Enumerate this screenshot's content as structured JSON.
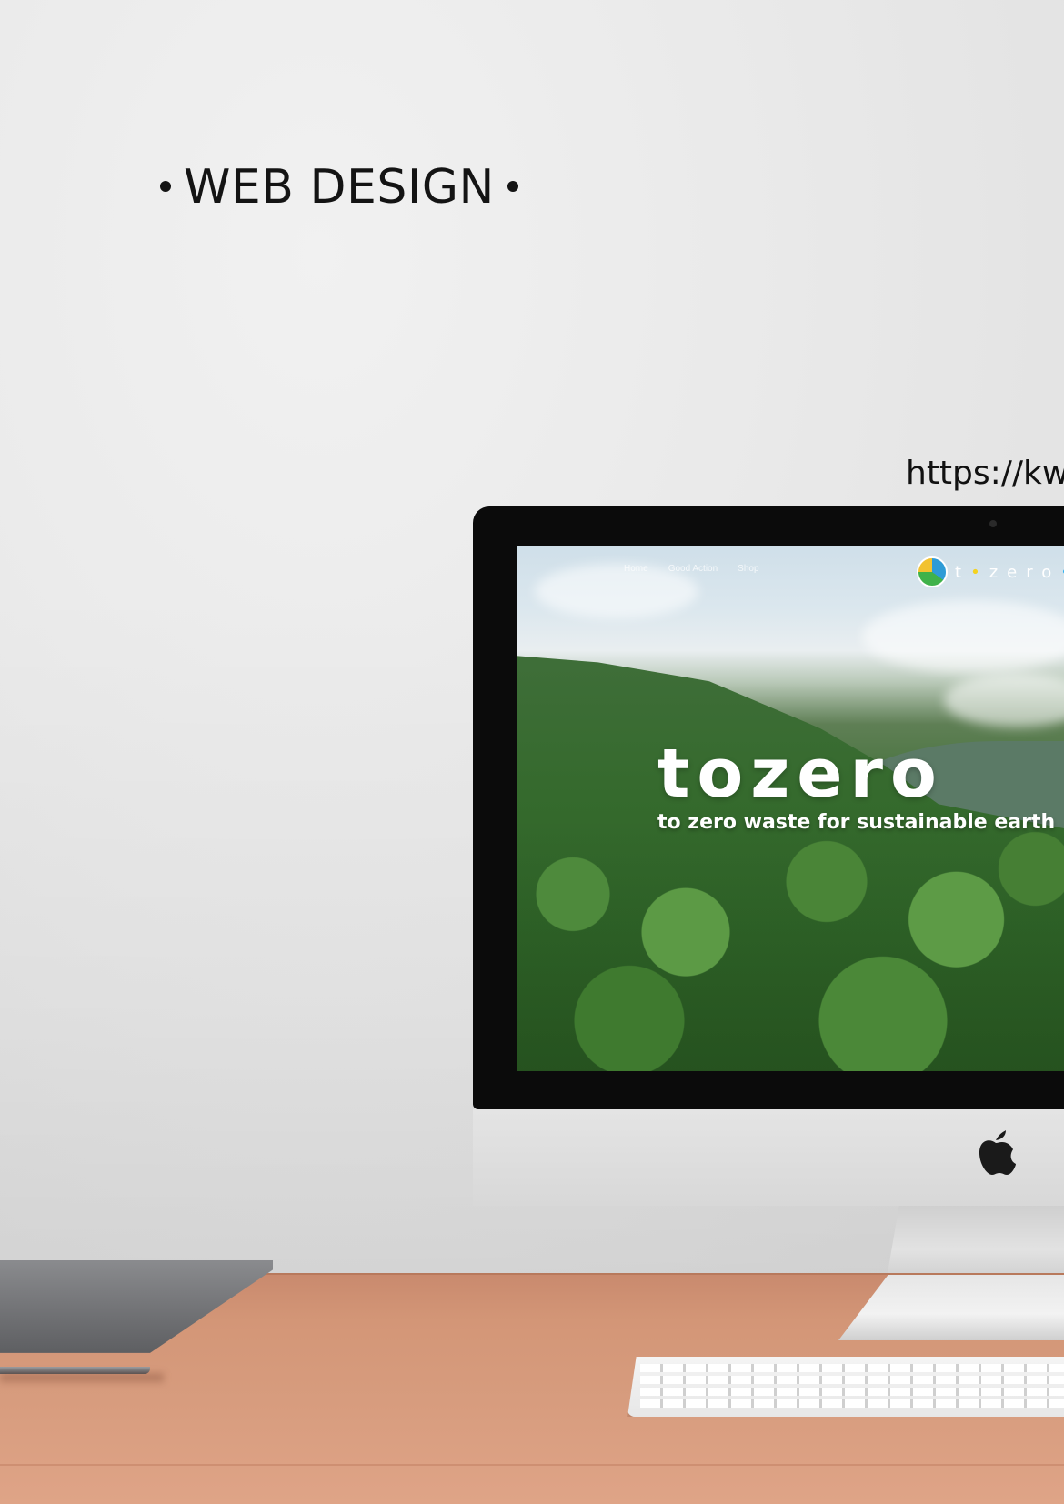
{
  "heading": "WEB DESIGN",
  "url_text": "https://kw",
  "website": {
    "nav_items": [
      "Home",
      "Good Action",
      "Shop"
    ],
    "logo_text": "tozero",
    "hero_title": "tozero",
    "hero_tagline": "to zero waste for sustainable earth"
  },
  "colors": {
    "wall": "#ececec",
    "desk": "#d39677",
    "imac_bezel": "#0b0b0b",
    "text_dark": "#141414",
    "logo_yellow": "#f4d21f",
    "logo_blue": "#2fb2f0"
  },
  "icons": {
    "apple_logo": "apple-icon",
    "site_logo": "tozero-logo-icon"
  }
}
